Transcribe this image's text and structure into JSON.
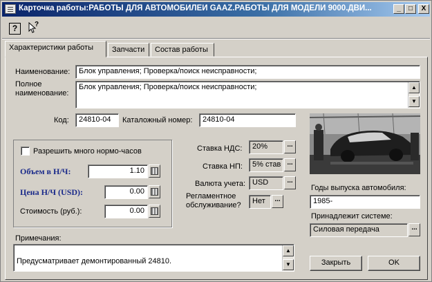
{
  "window": {
    "title": "Карточка работы:РАБОТЫ ДЛЯ АВТОМОБИЛЕЙ GAAZ.РАБОТЫ ДЛЯ МОДЕЛИ 9000.ДВИ...",
    "controls": {
      "minimize": "_",
      "maximize": "□",
      "close": "X"
    }
  },
  "toolbar": {
    "help": "?",
    "whats_this": "?"
  },
  "tabs": [
    {
      "label": "Характеристики работы",
      "active": true
    },
    {
      "label": "Запчасти",
      "active": false
    },
    {
      "label": "Состав работы",
      "active": false
    }
  ],
  "form": {
    "name_label": "Наименование:",
    "name_value": "Блок управления; Проверка/поиск неисправности;",
    "fullname_label_1": "Полное",
    "fullname_label_2": "наименование:",
    "fullname_value": "Блок управления; Проверка/поиск неисправности;",
    "code_label": "Код:",
    "code_value": "24810-04",
    "catalog_label": "Каталожный номер:",
    "catalog_value": "24810-04",
    "multi_hours_label": "Разрешить много нормо-часов",
    "multi_hours_checked": false,
    "volume_label": "Объем в Н/Ч:",
    "volume_value": "1.10",
    "price_label": "Цена Н/Ч (USD):",
    "price_value": "0.00",
    "cost_label": "Стоимость (руб.):",
    "cost_value": "0.00",
    "vat_label": "Ставка НДС:",
    "vat_value": "20%",
    "np_label": "Ставка НП:",
    "np_value": "5% став",
    "currency_label": "Валюта учета:",
    "currency_value": "USD",
    "maintenance_label_1": "Регламентное",
    "maintenance_label_2": "обслуживание?",
    "maintenance_value": "Нет",
    "years_label": "Годы выпуска автомобиля:",
    "years_value": "1985-",
    "system_label": "Принадлежит системе:",
    "system_value": "Силовая передача",
    "notes_label": "Примечания:",
    "notes_value": "Предусматривает демонтированный 24810.",
    "ellipsis": "..."
  },
  "buttons": {
    "close": "Закрыть",
    "ok": "OK"
  }
}
